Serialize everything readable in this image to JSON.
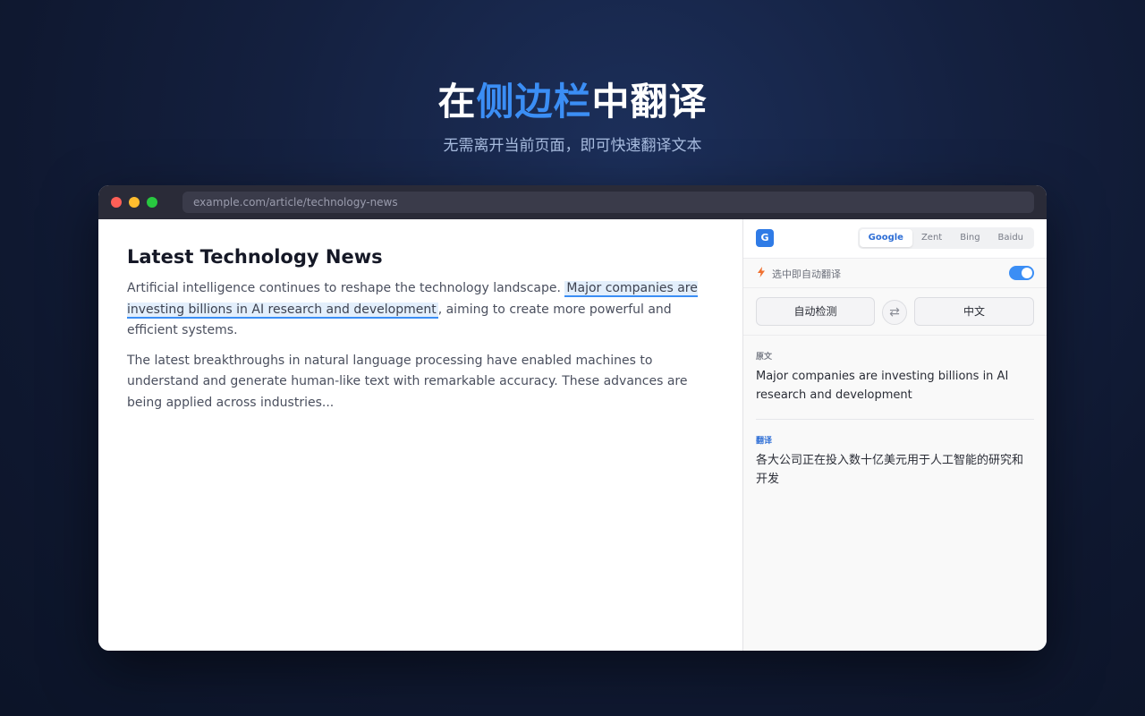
{
  "hero": {
    "title_part1": "在",
    "title_accent": "侧边栏",
    "title_part2": "中翻译",
    "subtitle": "无需离开当前页面，即可快速翻译文本"
  },
  "browser": {
    "url": "example.com/article/technology-news"
  },
  "article": {
    "title": "Latest Technology News",
    "p1_before": "Artificial intelligence continues to reshape the technology landscape. ",
    "p1_highlight": "Major companies are investing billions in AI research and development",
    "p1_after": ", aiming to create more powerful and efficient systems.",
    "p2": "The latest breakthroughs in natural language processing have enabled machines to understand and generate human-like text with remarkable accuracy. These advances are being applied across industries..."
  },
  "sidebar": {
    "logo_letter": "G",
    "engines": [
      "Google",
      "Zent",
      "Bing",
      "Baidu"
    ],
    "active_engine": "Google",
    "auto_translate_label": "选中即自动翻译",
    "auto_translate_on": true,
    "source_lang": "自动检测",
    "target_lang": "中文",
    "source_label": "原文",
    "source_text": "Major companies are investing billions in AI research and development",
    "translation_label": "翻译",
    "translation_text": "各大公司正在投入数十亿美元用于人工智能的研究和开发"
  },
  "colors": {
    "accent": "#3b8ef5",
    "engine_active": "#2f6fd6",
    "bolt": "#f07030"
  }
}
